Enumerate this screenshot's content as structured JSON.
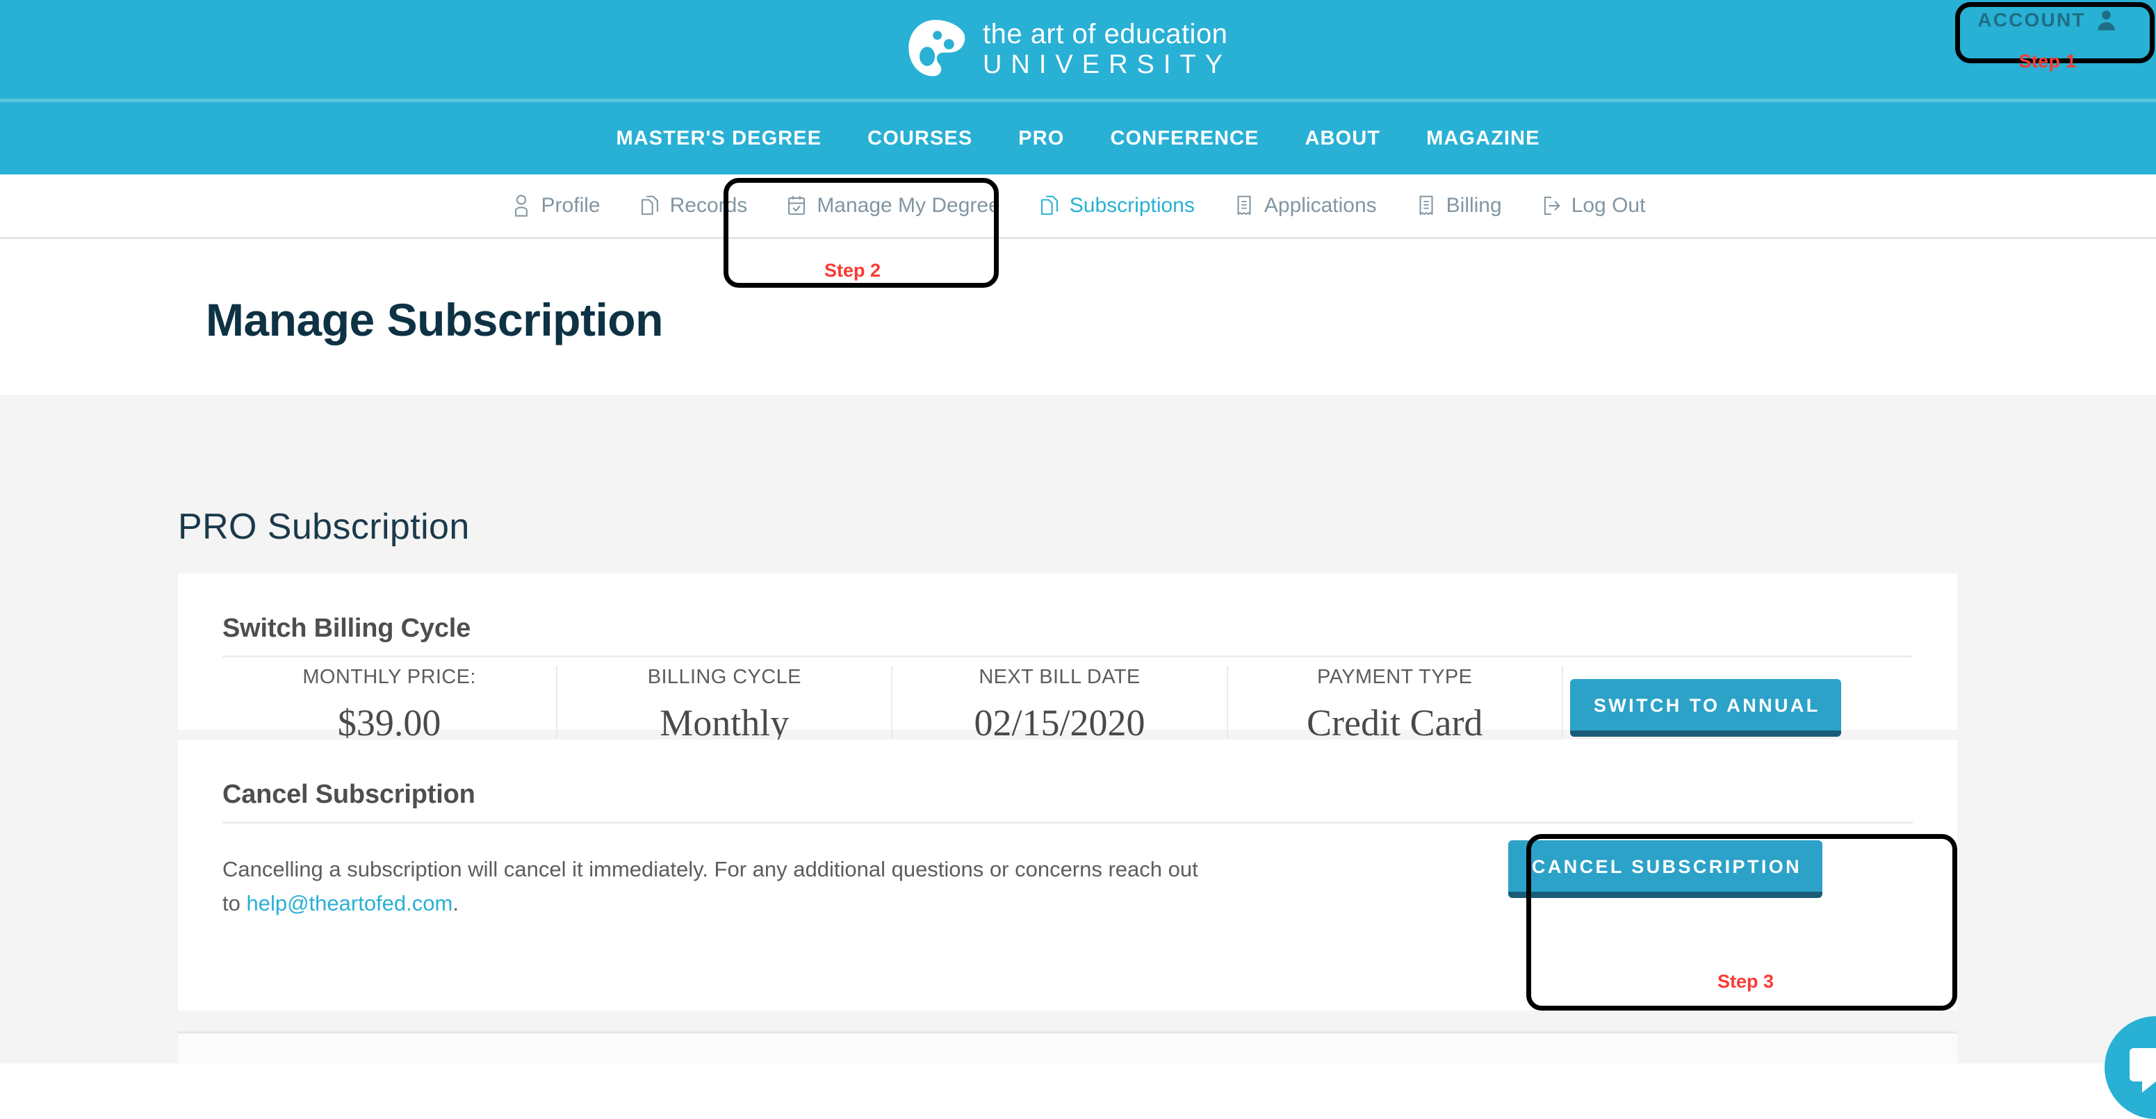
{
  "brand": {
    "logo_line1": "the art of education",
    "logo_line2": "UNIVERSITY",
    "logo_icon": "palette-icon",
    "accent_blue": "#29b0d5",
    "button_blue": "#2ca2c9",
    "button_shadow": "#1a5c77",
    "dark_navy": "#0e3244",
    "annotation_red": "#fb3a33"
  },
  "account": {
    "label": "ACCOUNT",
    "icon": "user-icon",
    "step": "Step 1"
  },
  "main_nav": {
    "items": [
      {
        "label": "MASTER'S DEGREE"
      },
      {
        "label": "COURSES"
      },
      {
        "label": "PRO"
      },
      {
        "label": "CONFERENCE"
      },
      {
        "label": "ABOUT"
      },
      {
        "label": "MAGAZINE"
      }
    ]
  },
  "sub_nav": {
    "items": [
      {
        "label": "Profile",
        "icon": "person-icon",
        "active": false
      },
      {
        "label": "Records",
        "icon": "copy-documents-icon",
        "active": false
      },
      {
        "label": "Manage My Degree",
        "icon": "calendar-check-icon",
        "active": false
      },
      {
        "label": "Subscriptions",
        "icon": "copy-documents-icon",
        "active": true
      },
      {
        "label": "Applications",
        "icon": "receipt-icon",
        "active": false
      },
      {
        "label": "Billing",
        "icon": "receipt-icon",
        "active": false
      },
      {
        "label": "Log Out",
        "icon": "sign-out-icon",
        "active": false
      }
    ],
    "step": "Step 2"
  },
  "page": {
    "title": "Manage Subscription",
    "section_title": "PRO Subscription"
  },
  "billing_card": {
    "heading": "Switch Billing Cycle",
    "stats": [
      {
        "label": "MONTHLY PRICE:",
        "value": "$39.00"
      },
      {
        "label": "BILLING CYCLE",
        "value": "Monthly"
      },
      {
        "label": "NEXT BILL DATE",
        "value": "02/15/2020"
      },
      {
        "label": "PAYMENT TYPE",
        "value": "Credit Card"
      }
    ],
    "switch_button": "SWITCH TO ANNUAL"
  },
  "cancel_card": {
    "heading": "Cancel Subscription",
    "body_before": "Cancelling a subscription will cancel it immediately. For any additional questions or concerns reach out to ",
    "email_link": "help@theartofed.com",
    "body_after": ".",
    "cancel_button": "CANCEL SUBSCRIPTION",
    "step": "Step 3"
  },
  "chat_widget": {
    "icon": "chat-bubble-icon"
  }
}
